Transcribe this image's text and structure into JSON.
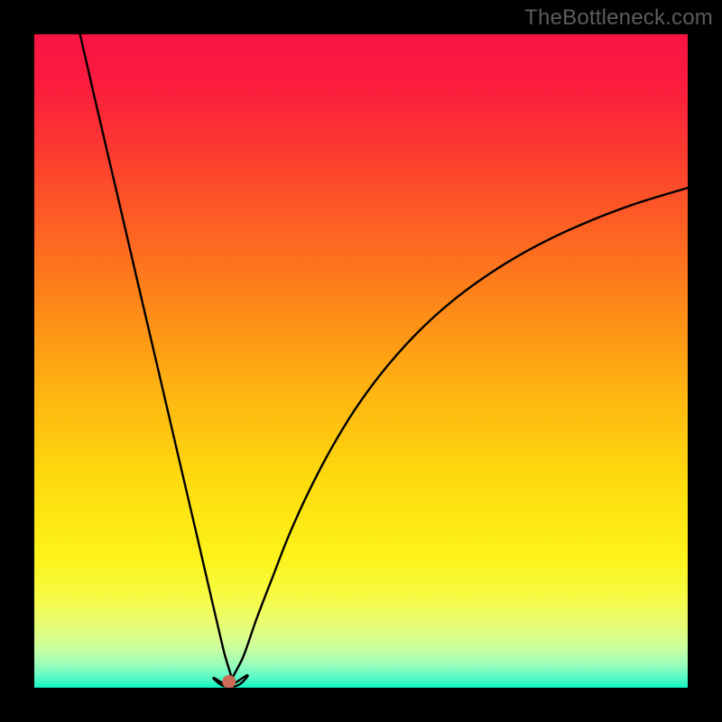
{
  "watermark": "TheBottleneck.com",
  "colors": {
    "frame": "#000000",
    "gradient_stops": [
      {
        "offset": 0.0,
        "color": "#fa1444"
      },
      {
        "offset": 0.08,
        "color": "#fb1c3e"
      },
      {
        "offset": 0.18,
        "color": "#fc3b30"
      },
      {
        "offset": 0.3,
        "color": "#fd6223"
      },
      {
        "offset": 0.42,
        "color": "#fd8a18"
      },
      {
        "offset": 0.55,
        "color": "#feb511"
      },
      {
        "offset": 0.68,
        "color": "#feda0e"
      },
      {
        "offset": 0.8,
        "color": "#fdf31a"
      },
      {
        "offset": 0.86,
        "color": "#f7fb44"
      },
      {
        "offset": 0.905,
        "color": "#e7fd75"
      },
      {
        "offset": 0.94,
        "color": "#caff9f"
      },
      {
        "offset": 0.965,
        "color": "#99fdbb"
      },
      {
        "offset": 0.985,
        "color": "#56f9c5"
      },
      {
        "offset": 1.0,
        "color": "#0ff5c4"
      }
    ],
    "curve": "#000000",
    "marker_fill": "#cd6b59",
    "marker_stroke": "#c5604f"
  },
  "chart_data": {
    "type": "line",
    "title": "",
    "xlabel": "",
    "ylabel": "",
    "xlim": [
      0,
      100
    ],
    "ylim": [
      0,
      100
    ],
    "grid": false,
    "marker": {
      "x": 29.8,
      "y": 0.9
    },
    "series": [
      {
        "name": "left-branch",
        "x": [
          7.0,
          10.0,
          13.0,
          16.0,
          19.0,
          22.0,
          25.0,
          27.5,
          29.0,
          30.3
        ],
        "y": [
          100.0,
          87.0,
          74.2,
          61.3,
          48.5,
          35.6,
          22.8,
          12.0,
          5.6,
          0.3
        ]
      },
      {
        "name": "valley",
        "x": [
          27.5,
          28.2,
          29.0,
          30.0,
          31.0,
          31.8,
          32.6
        ],
        "y": [
          1.5,
          0.7,
          0.25,
          0.15,
          0.3,
          0.8,
          1.9
        ]
      },
      {
        "name": "right-branch",
        "x": [
          30.0,
          32.0,
          34.0,
          36.5,
          39.0,
          42.0,
          45.5,
          49.5,
          54.0,
          59.0,
          64.5,
          70.5,
          77.0,
          84.0,
          91.5,
          100.0
        ],
        "y": [
          0.6,
          4.8,
          10.5,
          17.0,
          23.4,
          30.0,
          36.7,
          43.2,
          49.2,
          54.7,
          59.6,
          63.9,
          67.7,
          71.0,
          73.9,
          76.5
        ]
      }
    ]
  }
}
